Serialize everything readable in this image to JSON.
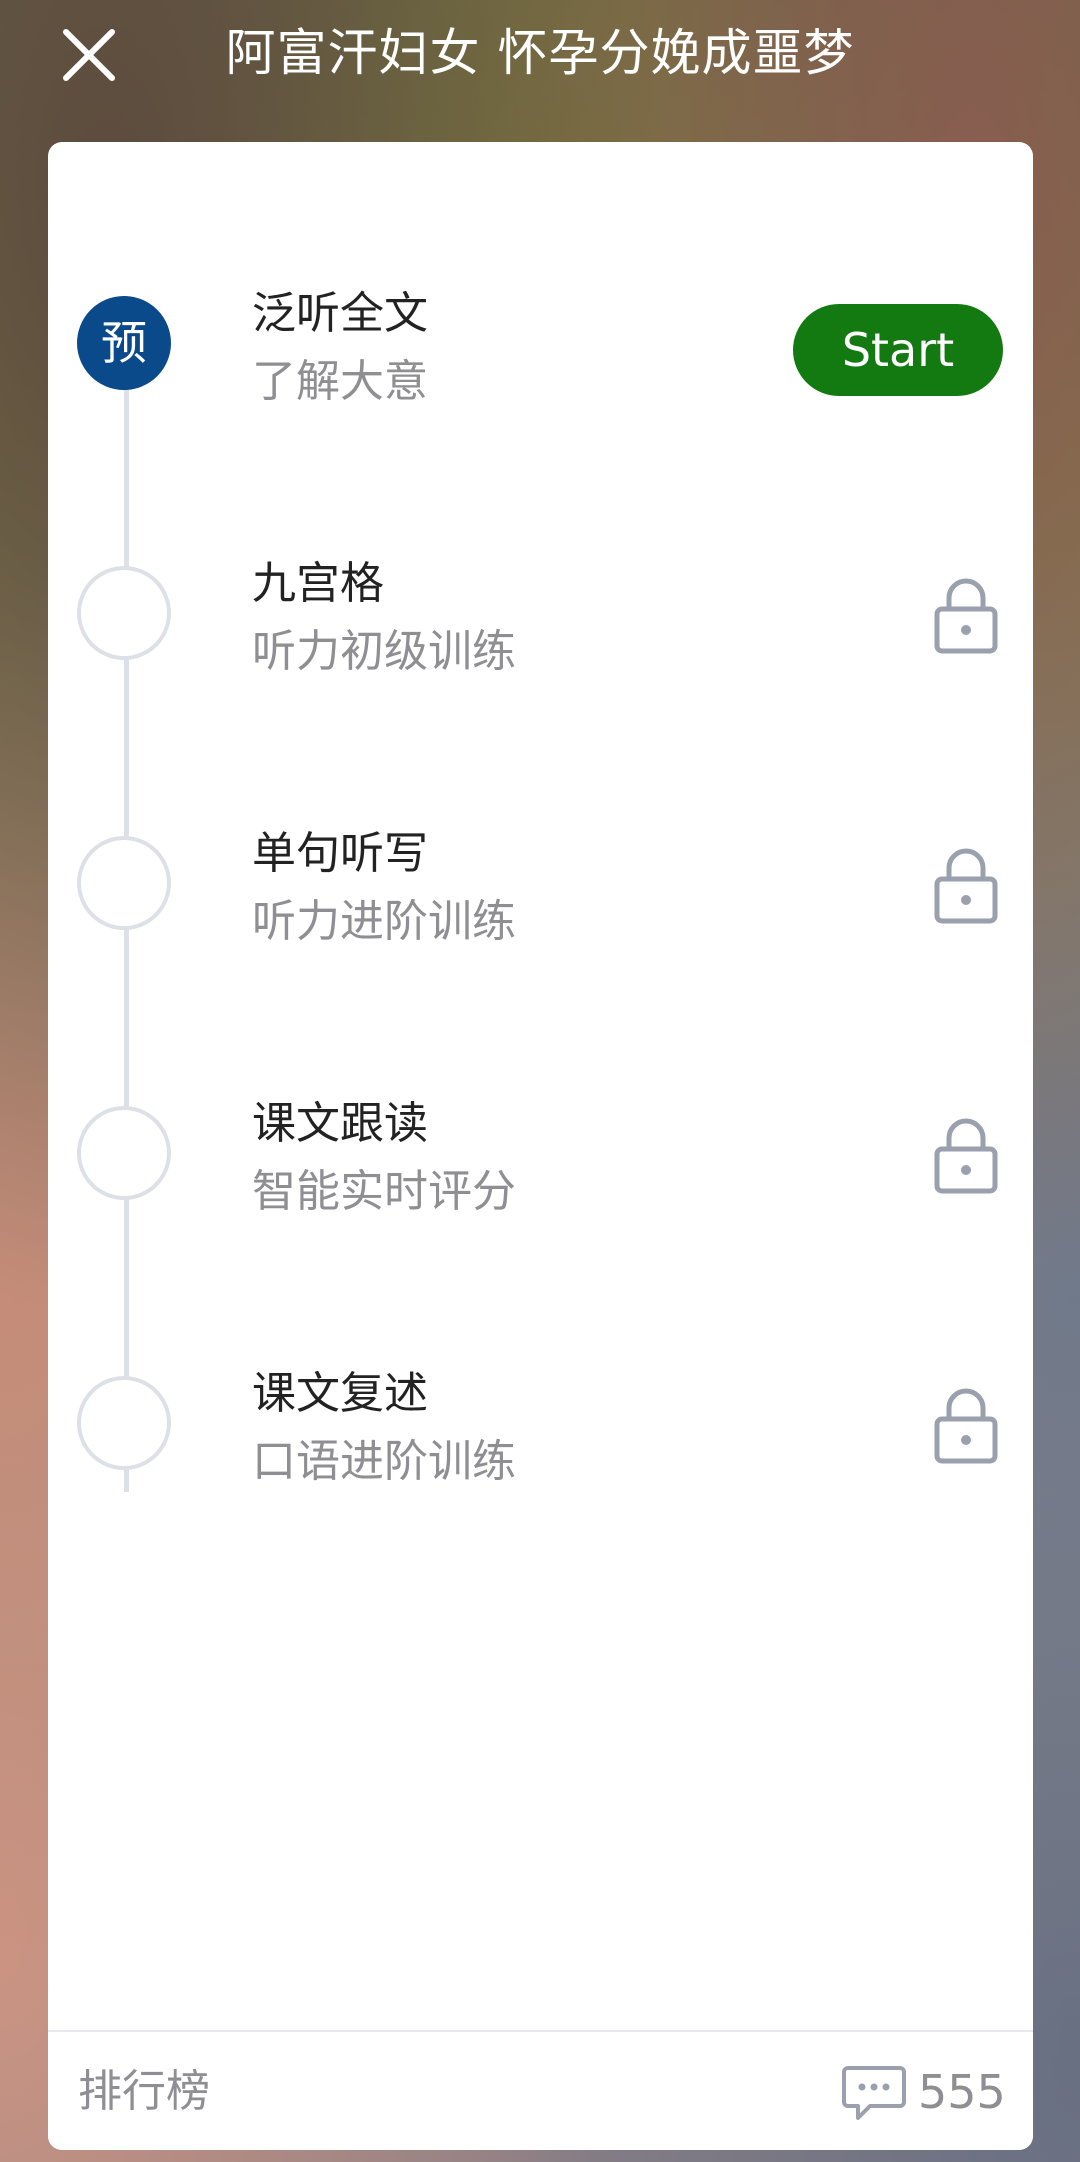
{
  "header": {
    "title": "阿富汗妇女 怀孕分娩成噩梦",
    "close_icon": "close-icon"
  },
  "steps": [
    {
      "badge": "预",
      "title": "泛听全文",
      "subtitle": "了解大意",
      "state": "active",
      "action_label": "Start"
    },
    {
      "badge": "",
      "title": "九宫格",
      "subtitle": "听力初级训练",
      "state": "locked"
    },
    {
      "badge": "",
      "title": "单句听写",
      "subtitle": "听力进阶训练",
      "state": "locked"
    },
    {
      "badge": "",
      "title": "课文跟读",
      "subtitle": "智能实时评分",
      "state": "locked"
    },
    {
      "badge": "",
      "title": "课文复述",
      "subtitle": "口语进阶训练",
      "state": "locked"
    }
  ],
  "footer": {
    "rank_label": "排行榜",
    "comment_icon": "comment-icon",
    "comment_count": "555"
  },
  "colors": {
    "active_badge": "#0a4a8a",
    "start_button": "#137a11",
    "lock_icon": "#9aa0ad",
    "timeline": "#dde1e7"
  }
}
